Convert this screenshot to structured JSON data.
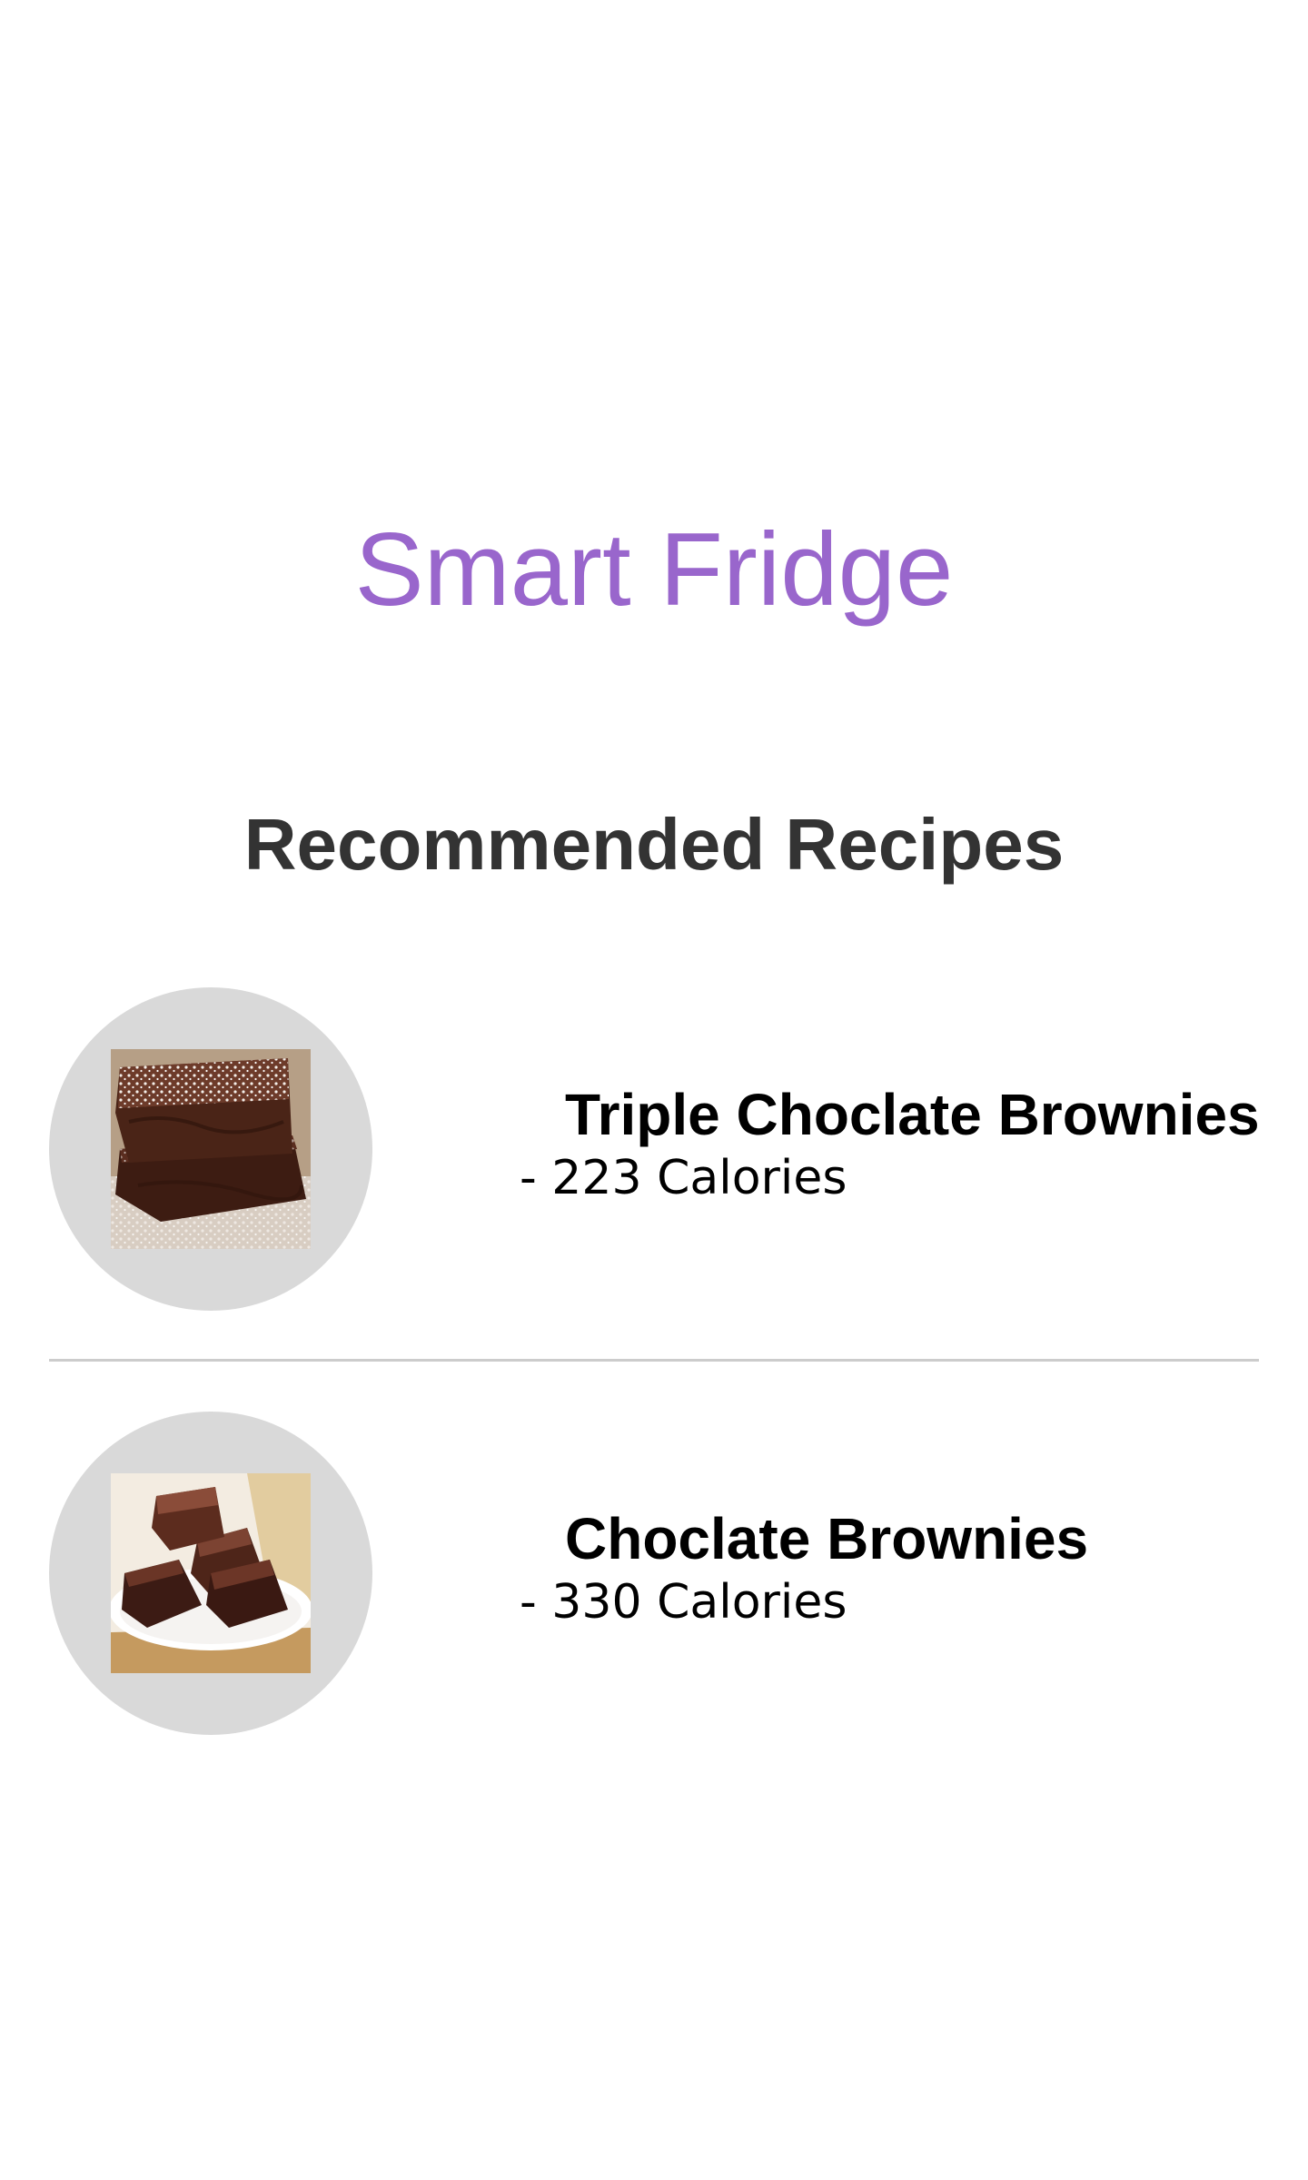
{
  "app": {
    "title": "Smart Fridge",
    "title_color": "#9966cc"
  },
  "recommended": {
    "heading": "Recommended Recipes"
  },
  "recipes": [
    {
      "name": "Triple Choclate Brownies",
      "calories": "- 223 Calories",
      "image_icon": "stacked-brownies-photo"
    },
    {
      "name": "Choclate Brownies",
      "calories": "- 330 Calories",
      "image_icon": "plated-brownies-photo"
    }
  ],
  "colors": {
    "thumb_background": "#d9d9d9",
    "divider": "#cccccc",
    "heading_text": "#333333"
  }
}
